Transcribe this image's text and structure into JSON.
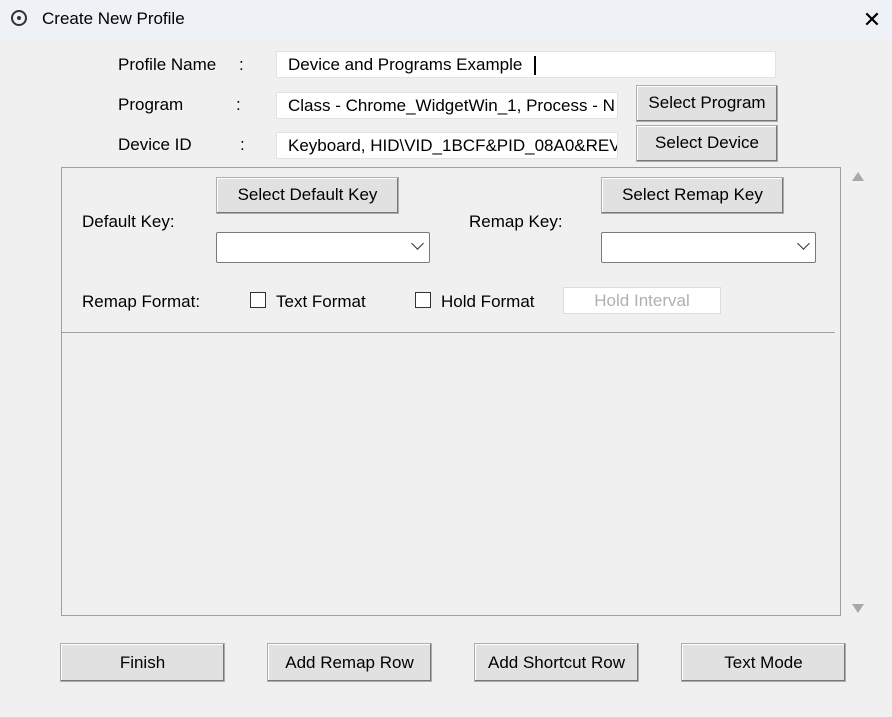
{
  "window": {
    "title": "Create New Profile",
    "close_glyph": "✕"
  },
  "form": {
    "profile_name_label": "Profile Name",
    "program_label": "Program",
    "device_id_label": "Device ID",
    "colon": ":",
    "profile_name_value": "Device and Programs Example",
    "program_value": "Class - Chrome_WidgetWin_1, Process - N",
    "device_id_value": "Keyboard, HID\\VID_1BCF&PID_08A0&REV",
    "select_program_label": "Select Program",
    "select_device_label": "Select Device"
  },
  "remap": {
    "default_key_label": "Default Key:",
    "select_default_key_label": "Select Default Key",
    "remap_key_label": "Remap Key:",
    "select_remap_key_label": "Select Remap Key",
    "default_key_value": "",
    "remap_key_value": "",
    "remap_format_label": "Remap Format:",
    "text_format_label": "Text Format",
    "text_format_checked": false,
    "hold_format_label": "Hold Format",
    "hold_format_checked": false,
    "hold_interval_placeholder": "Hold Interval"
  },
  "footer": {
    "finish_label": "Finish",
    "add_remap_row_label": "Add Remap Row",
    "add_shortcut_row_label": "Add Shortcut Row",
    "text_mode_label": "Text Mode"
  },
  "icons": {
    "app": "app-icon",
    "close": "close-icon",
    "scroll_up": "scroll-up-arrow-icon",
    "scroll_down": "scroll-down-arrow-icon",
    "dropdown": "chevron-down-icon"
  }
}
